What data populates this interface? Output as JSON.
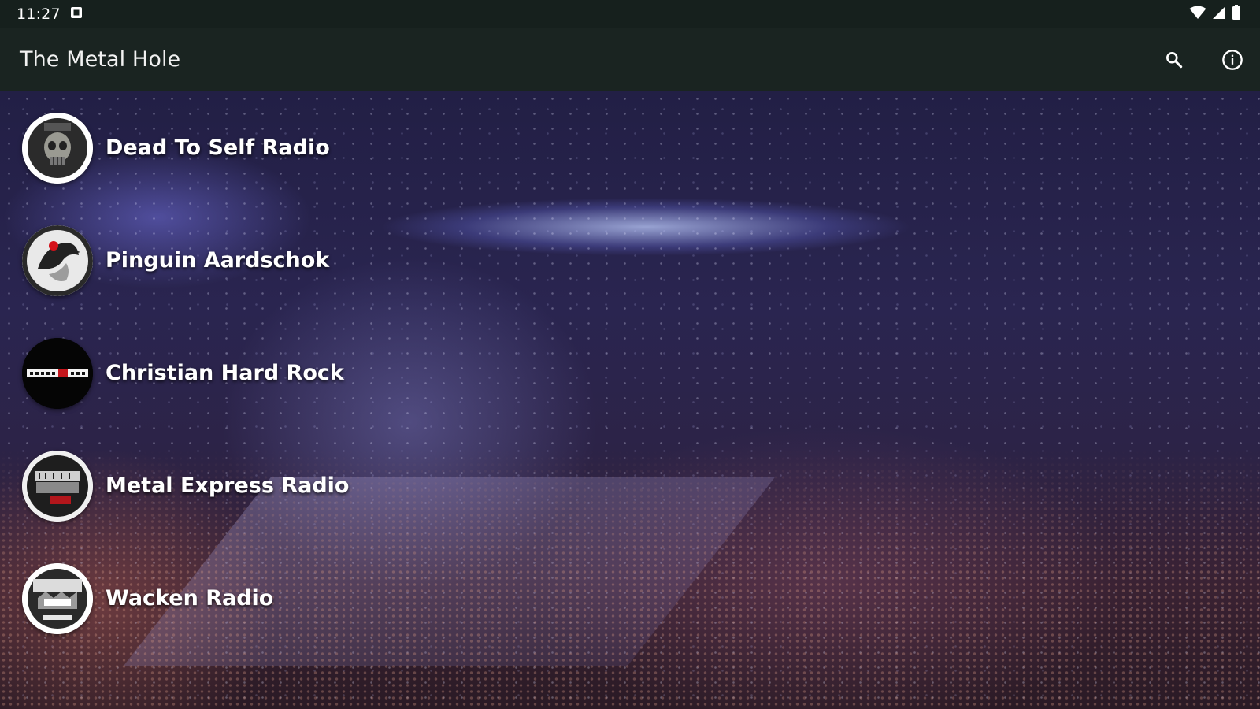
{
  "status_bar": {
    "time": "11:27",
    "icons": [
      "notification-icon",
      "wifi-icon",
      "signal-icon",
      "battery-icon"
    ]
  },
  "app_bar": {
    "title": "The Metal Hole",
    "actions": [
      {
        "icon": "search-icon"
      },
      {
        "icon": "info-icon"
      }
    ]
  },
  "stations": [
    {
      "name": "Dead To Self Radio",
      "logo_icon": "dead-to-self-logo-icon"
    },
    {
      "name": "Pinguin Aardschok",
      "logo_icon": "pinguin-logo-icon"
    },
    {
      "name": "Christian Hard Rock",
      "logo_icon": "christian-hard-rock-logo-icon"
    },
    {
      "name": "Metal Express Radio",
      "logo_icon": "metal-express-logo-icon"
    },
    {
      "name": "Wacken Radio",
      "logo_icon": "wacken-logo-icon"
    }
  ],
  "colors": {
    "status_bar_bg": "#16201d",
    "app_bar_bg": "#1a2421",
    "text": "#ffffff"
  }
}
